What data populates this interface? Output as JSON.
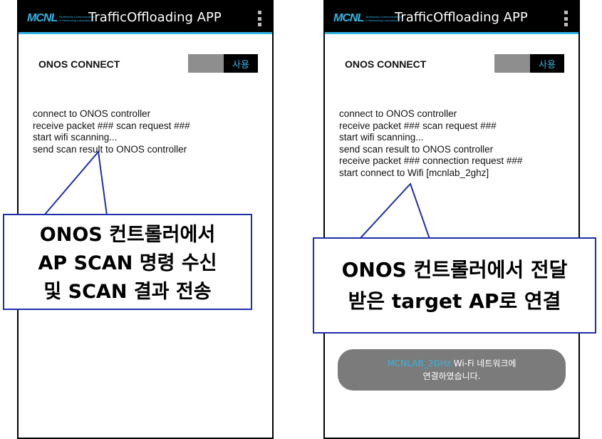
{
  "app": {
    "logo_mark": "MCNL",
    "logo_sub_line1": "Multimedia Communications",
    "logo_sub_line2": "& Networking Laboratory",
    "title": "TrafficOffloading APP"
  },
  "left_screen": {
    "onos_label": "ONOS CONNECT",
    "switch_label": "사용",
    "log_lines": [
      "connect to ONOS controller",
      "receive packet ### scan request ###",
      "start wifi scanning...",
      "send scan result to ONOS controller"
    ]
  },
  "right_screen": {
    "onos_label": "ONOS CONNECT",
    "switch_label": "사용",
    "log_lines": [
      "connect to ONOS controller",
      "receive packet ### scan request ###",
      "start wifi scanning...",
      "send scan result to ONOS controller",
      "receive packet ### connection request ###",
      "start connect to Wifi [mcnlab_2ghz]"
    ],
    "toast": {
      "ssid": "MCNLAB_2GHz",
      "line1_rest": " Wi-Fi 네트워크에",
      "line2": "연결하였습니다."
    }
  },
  "callouts": {
    "left_lines": [
      "ONOS 컨트롤러에서",
      "AP SCAN 명령 수신",
      "및 SCAN 결과 전송"
    ],
    "right_lines": [
      "ONOS 컨트롤러에서 전달",
      "받은 target AP로 연결"
    ]
  },
  "colors": {
    "accent": "#33b5e5",
    "appbar": "#000000",
    "callout_border": "#1f2fa8",
    "toast_bg": "#7b7b7b"
  }
}
